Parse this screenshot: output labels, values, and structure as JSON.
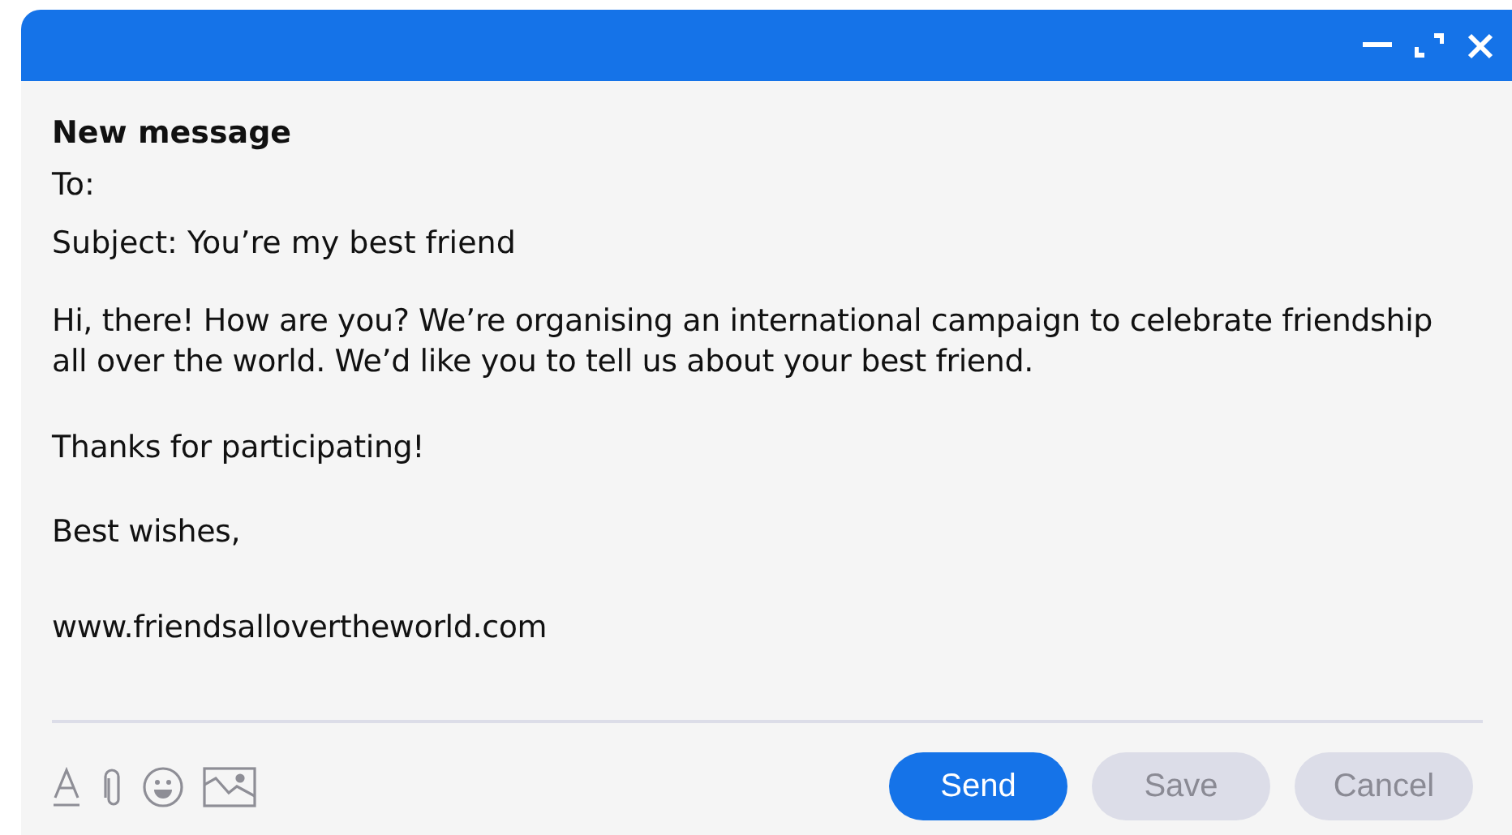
{
  "window": {
    "title": "New message"
  },
  "fields": [
    {
      "label": "To:"
    },
    {
      "label": "Subject:",
      "value": "You’re my best friend"
    }
  ],
  "body": [
    "Hi, there! How are you? We’re organising an international campaign to celebrate friendship all over the world. We’d like you to tell us about your best friend.",
    "Thanks for participating!",
    "Best wishes,",
    "www.friendsallovertheworld.com"
  ],
  "buttons": [
    {
      "label": "Send",
      "kind": "primary"
    },
    {
      "label": "Save",
      "kind": "secondary"
    },
    {
      "label": "Cancel",
      "kind": "secondary"
    }
  ]
}
